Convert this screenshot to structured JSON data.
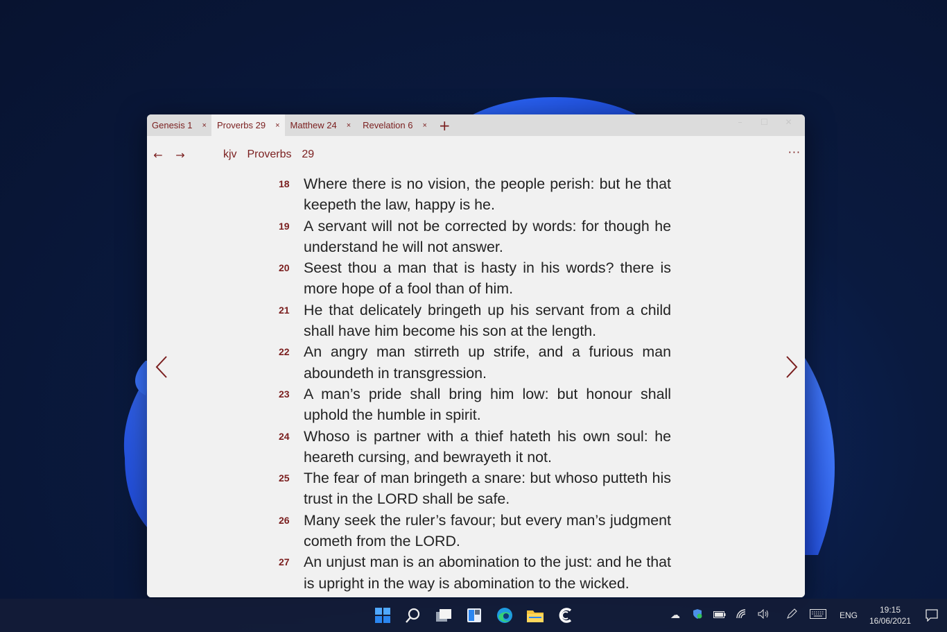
{
  "tabs": [
    {
      "label": "Genesis 1",
      "close": "×"
    },
    {
      "label": "Proverbs 29",
      "close": "×"
    },
    {
      "label": "Matthew 24",
      "close": "×"
    },
    {
      "label": "Revelation 6",
      "close": "×"
    }
  ],
  "tab_add": "+",
  "window_controls": {
    "minimize": "–",
    "maximize": "☐",
    "close": "✕"
  },
  "toolbar": {
    "back": "←",
    "forward": "→",
    "breadcrumb": "kjv  Proverbs  29",
    "more": "···"
  },
  "verses": [
    {
      "num": "18",
      "text": "Where there is no vision, the people perish: but he that keepeth the law, happy is he."
    },
    {
      "num": "19",
      "text": "A servant will not be corrected by words: for though he understand he will not answer."
    },
    {
      "num": "20",
      "text": "Seest thou a man that is hasty in his words? there is more hope of a fool than of him."
    },
    {
      "num": "21",
      "text": "He that delicately bringeth up his servant from a child shall have him become his son at the length."
    },
    {
      "num": "22",
      "text": "An angry man stirreth up strife, and a furious man aboundeth in transgression."
    },
    {
      "num": "23",
      "text": "A man’s pride shall bring him low: but honour shall uphold the humble in spirit."
    },
    {
      "num": "24",
      "text": "Whoso is partner with a thief hateth his own soul: he heareth cursing, and bewrayeth it not."
    },
    {
      "num": "25",
      "text": "The fear of man bringeth a snare: but whoso putteth his trust in the LORD shall be safe."
    },
    {
      "num": "26",
      "text": "Many seek the ruler’s favour; but every man’s judgment cometh from the LORD."
    },
    {
      "num": "27",
      "text": "An unjust man is an abomination to the just: and he that is upright in the way is abomination to the wicked."
    }
  ],
  "taskbar": {
    "icons": [
      "start-icon",
      "search-icon",
      "task-view-icon",
      "widgets-icon",
      "edge-icon",
      "file-explorer-icon",
      "bible-app-icon"
    ],
    "tray": {
      "lang": "ENG",
      "time": "19:15",
      "date": "16/06/2021"
    }
  },
  "colors": {
    "accent": "#7a1e1e",
    "window_bg": "#f1f1f1",
    "tabbar_bg": "#dcdcdc"
  }
}
